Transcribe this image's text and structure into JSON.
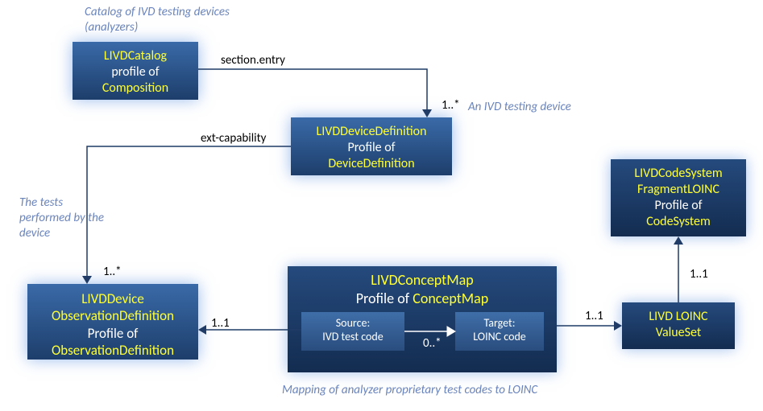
{
  "captions": {
    "catalog": "Catalog of IVD testing devices (analyzers)",
    "device": "An IVD testing device",
    "tests": "The tests performed by the device",
    "mapping": "Mapping of analyzer proprietary test codes to LOINC"
  },
  "nodes": {
    "catalog": {
      "l1": "LIVDCatalog",
      "l2": "profile of",
      "l3": "Composition"
    },
    "devicedef": {
      "l1": "LIVDDeviceDefinition",
      "l2": "Profile of",
      "l3": "DeviceDefinition"
    },
    "obsdef": {
      "l1_a": "LIVDDevice",
      "l1_b": "ObservationDefinition",
      "l2": "Profile of",
      "l3": "ObservationDefinition"
    },
    "conceptmap": {
      "l1": "LIVDConceptMap",
      "l2a": "Profile of ",
      "l2b": "ConceptMap",
      "source_a": "Source:",
      "source_b": "IVD test code",
      "target_a": "Target:",
      "target_b": "LOINC code"
    },
    "valueset": {
      "l1": "LIVD LOINC",
      "l2": "ValueSet"
    },
    "codesystem": {
      "l1": "LIVDCodeSystem",
      "l2": "FragmentLOINC",
      "l3": "Profile of",
      "l4": "CodeSystem"
    }
  },
  "edges": {
    "section_entry": "section.entry",
    "section_entry_card": "1..*",
    "ext_capability": "ext-capability",
    "ext_capability_card": "1..*",
    "cm_to_obs_card": "1..1",
    "cm_inner_card": "0..*",
    "cm_to_vs_card": "1..1",
    "vs_to_cs_card": "1..1"
  }
}
